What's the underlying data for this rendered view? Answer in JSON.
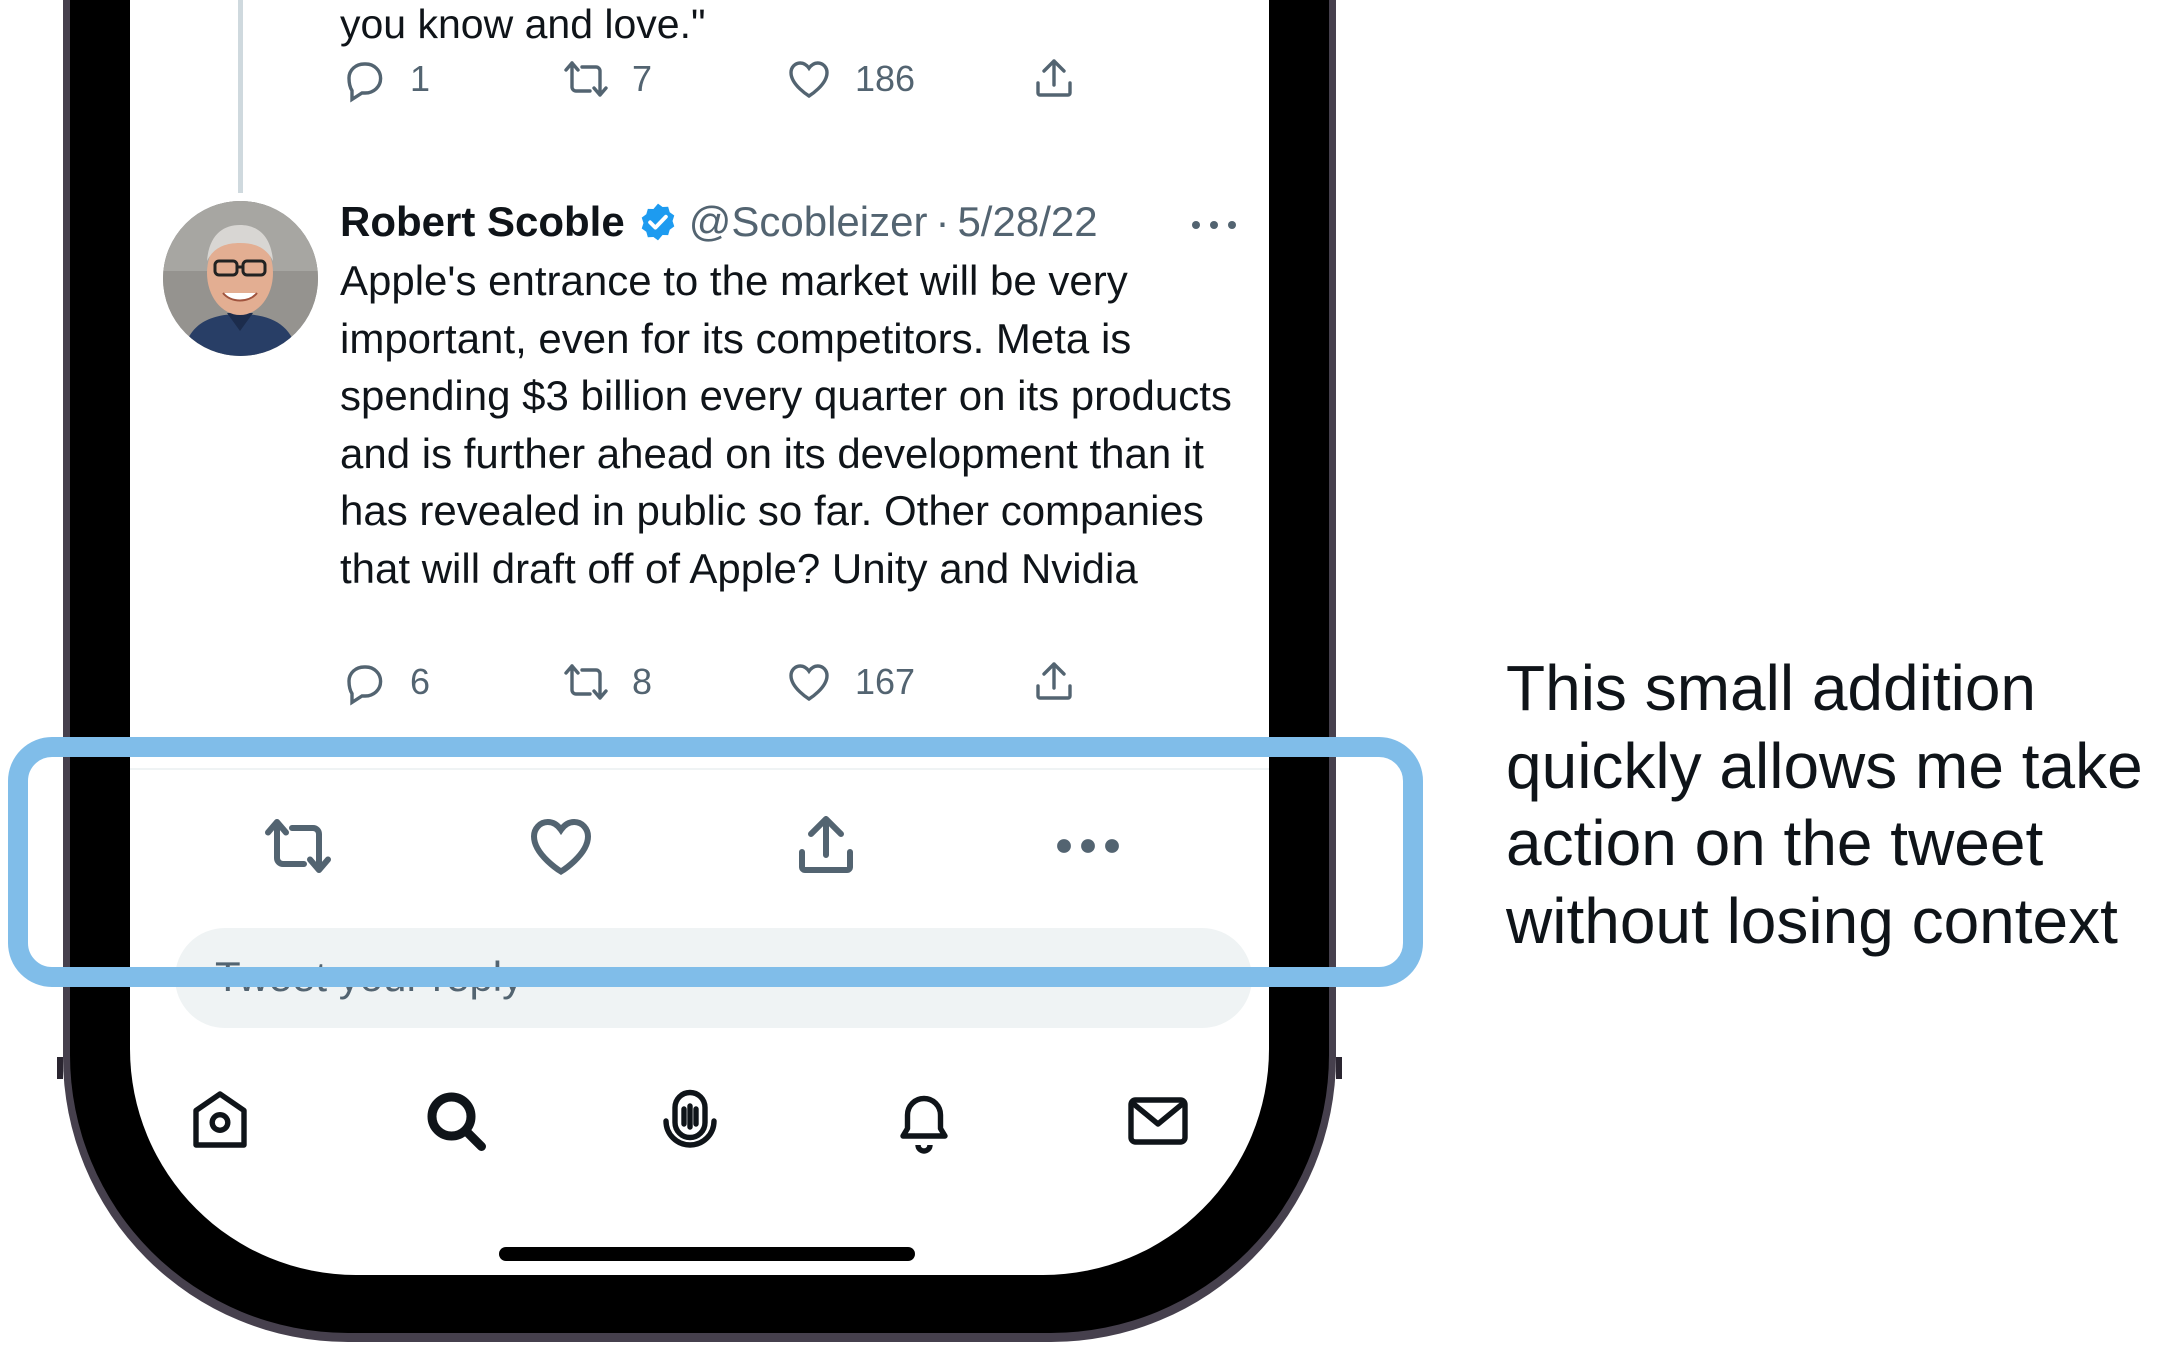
{
  "previous_tweet": {
    "text_end": "you know and love.\"",
    "replies": "1",
    "retweets": "7",
    "likes": "186"
  },
  "tweet": {
    "author_name": "Robert Scoble",
    "handle": "@Scobleizer",
    "separator": "·",
    "date": "5/28/22",
    "text": "Apple's entrance to the market will be very important, even for its competitors. Meta is spending $3 billion every quarter on its products and is further ahead on its development than it has revealed in public so far. Other companies that will draft off of Apple? Unity and Nvidia",
    "replies": "6",
    "retweets": "8",
    "likes": "167"
  },
  "action_bar": [
    "retweet-icon",
    "heart-icon",
    "share-icon",
    "more-icon"
  ],
  "reply": {
    "placeholder": "Tweet your reply"
  },
  "tab_bar": [
    "home-icon",
    "search-icon",
    "spaces-icon",
    "notifications-icon",
    "messages-icon"
  ],
  "caption": "This small addition quickly allows me take action on the tweet without losing context",
  "colors": {
    "highlight": "#80bde9",
    "verified": "#1d9bf0",
    "secondary_text": "#536471"
  }
}
